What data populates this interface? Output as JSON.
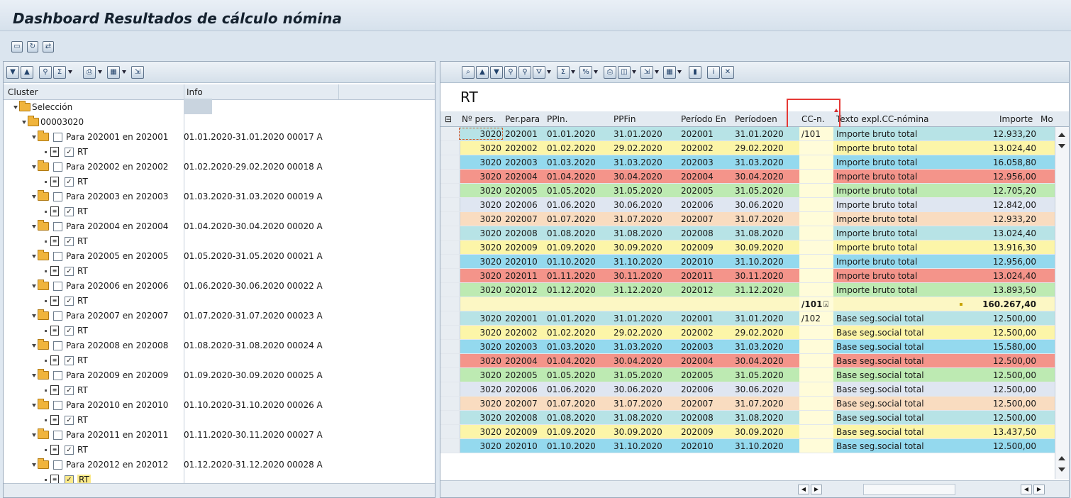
{
  "app": {
    "title": "Dashboard Resultados de cálculo nómina",
    "toolbar_icons": [
      "display-icon",
      "refresh-icon",
      "transfer-icon"
    ]
  },
  "tree": {
    "headers": {
      "cluster": "Cluster",
      "info": "Info"
    },
    "root": "Selección",
    "person": "00003020",
    "rt_label": "RT",
    "periods": [
      {
        "label": "Para 202001 en 202001",
        "info": "01.01.2020-31.01.2020 00017 A"
      },
      {
        "label": "Para 202002 en 202002",
        "info": "01.02.2020-29.02.2020 00018 A"
      },
      {
        "label": "Para 202003 en 202003",
        "info": "01.03.2020-31.03.2020 00019 A"
      },
      {
        "label": "Para 202004 en 202004",
        "info": "01.04.2020-30.04.2020 00020 A"
      },
      {
        "label": "Para 202005 en 202005",
        "info": "01.05.2020-31.05.2020 00021 A"
      },
      {
        "label": "Para 202006 en 202006",
        "info": "01.06.2020-30.06.2020 00022 A"
      },
      {
        "label": "Para 202007 en 202007",
        "info": "01.07.2020-31.07.2020 00023 A"
      },
      {
        "label": "Para 202008 en 202008",
        "info": "01.08.2020-31.08.2020 00024 A"
      },
      {
        "label": "Para 202009 en 202009",
        "info": "01.09.2020-30.09.2020 00025 A"
      },
      {
        "label": "Para 202010 en 202010",
        "info": "01.10.2020-31.10.2020 00026 A"
      },
      {
        "label": "Para 202011 en 202011",
        "info": "01.11.2020-30.11.2020 00027 A"
      },
      {
        "label": "Para 202012 en 202012",
        "info": "01.12.2020-31.12.2020 00028 A"
      }
    ]
  },
  "grid": {
    "title": "RT",
    "headers": {
      "pers": "Nº pers.",
      "perpara": "Per.para",
      "ppin": "PPIn.",
      "ppfin": "PPFin",
      "periodo_en": "Período En",
      "periodoen": "Períodoen",
      "cc": "CC-n.",
      "texto": "Texto expl.CC-nómina",
      "importe": "Importe",
      "mo": "Mo"
    },
    "rows": [
      {
        "pers": "3020",
        "perpara": "202001",
        "ppin": "01.01.2020",
        "ppfin": "31.01.2020",
        "periodo_en": "202001",
        "periodoen": "31.01.2020",
        "cc": "/101",
        "texto": "Importe bruto total",
        "importe": "12.933,20",
        "color": "#b7e3e6"
      },
      {
        "pers": "3020",
        "perpara": "202002",
        "ppin": "01.02.2020",
        "ppfin": "29.02.2020",
        "periodo_en": "202002",
        "periodoen": "29.02.2020",
        "cc": "",
        "texto": "Importe bruto total",
        "importe": "13.024,40",
        "color": "#fcf5a8"
      },
      {
        "pers": "3020",
        "perpara": "202003",
        "ppin": "01.03.2020",
        "ppfin": "31.03.2020",
        "periodo_en": "202003",
        "periodoen": "31.03.2020",
        "cc": "",
        "texto": "Importe bruto total",
        "importe": "16.058,80",
        "color": "#94d9ee"
      },
      {
        "pers": "3020",
        "perpara": "202004",
        "ppin": "01.04.2020",
        "ppfin": "30.04.2020",
        "periodo_en": "202004",
        "periodoen": "30.04.2020",
        "cc": "",
        "texto": "Importe bruto total",
        "importe": "12.956,00",
        "color": "#f4948a"
      },
      {
        "pers": "3020",
        "perpara": "202005",
        "ppin": "01.05.2020",
        "ppfin": "31.05.2020",
        "periodo_en": "202005",
        "periodoen": "31.05.2020",
        "cc": "",
        "texto": "Importe bruto total",
        "importe": "12.705,20",
        "color": "#bdeab2"
      },
      {
        "pers": "3020",
        "perpara": "202006",
        "ppin": "01.06.2020",
        "ppfin": "30.06.2020",
        "periodo_en": "202006",
        "periodoen": "30.06.2020",
        "cc": "",
        "texto": "Importe bruto total",
        "importe": "12.842,00",
        "color": "#dfe6f1"
      },
      {
        "pers": "3020",
        "perpara": "202007",
        "ppin": "01.07.2020",
        "ppfin": "31.07.2020",
        "periodo_en": "202007",
        "periodoen": "31.07.2020",
        "cc": "",
        "texto": "Importe bruto total",
        "importe": "12.933,20",
        "color": "#f9dcc0"
      },
      {
        "pers": "3020",
        "perpara": "202008",
        "ppin": "01.08.2020",
        "ppfin": "31.08.2020",
        "periodo_en": "202008",
        "periodoen": "31.08.2020",
        "cc": "",
        "texto": "Importe bruto total",
        "importe": "13.024,40",
        "color": "#b7e3e6"
      },
      {
        "pers": "3020",
        "perpara": "202009",
        "ppin": "01.09.2020",
        "ppfin": "30.09.2020",
        "periodo_en": "202009",
        "periodoen": "30.09.2020",
        "cc": "",
        "texto": "Importe bruto total",
        "importe": "13.916,30",
        "color": "#fcf5a8"
      },
      {
        "pers": "3020",
        "perpara": "202010",
        "ppin": "01.10.2020",
        "ppfin": "31.10.2020",
        "periodo_en": "202010",
        "periodoen": "31.10.2020",
        "cc": "",
        "texto": "Importe bruto total",
        "importe": "12.956,00",
        "color": "#94d9ee"
      },
      {
        "pers": "3020",
        "perpara": "202011",
        "ppin": "01.11.2020",
        "ppfin": "30.11.2020",
        "periodo_en": "202011",
        "periodoen": "30.11.2020",
        "cc": "",
        "texto": "Importe bruto total",
        "importe": "13.024,40",
        "color": "#f4948a"
      },
      {
        "pers": "3020",
        "perpara": "202012",
        "ppin": "01.12.2020",
        "ppfin": "31.12.2020",
        "periodo_en": "202012",
        "periodoen": "31.12.2020",
        "cc": "",
        "texto": "Importe bruto total",
        "importe": "13.893,50",
        "color": "#bdeab2"
      },
      {
        "total": true,
        "cc": "/101",
        "importe": "160.267,40",
        "color": "#fcf7c4"
      },
      {
        "pers": "3020",
        "perpara": "202001",
        "ppin": "01.01.2020",
        "ppfin": "31.01.2020",
        "periodo_en": "202001",
        "periodoen": "31.01.2020",
        "cc": "/102",
        "texto": "Base seg.social total",
        "importe": "12.500,00",
        "color": "#b7e3e6"
      },
      {
        "pers": "3020",
        "perpara": "202002",
        "ppin": "01.02.2020",
        "ppfin": "29.02.2020",
        "periodo_en": "202002",
        "periodoen": "29.02.2020",
        "cc": "",
        "texto": "Base seg.social total",
        "importe": "12.500,00",
        "color": "#fcf5a8"
      },
      {
        "pers": "3020",
        "perpara": "202003",
        "ppin": "01.03.2020",
        "ppfin": "31.03.2020",
        "periodo_en": "202003",
        "periodoen": "31.03.2020",
        "cc": "",
        "texto": "Base seg.social total",
        "importe": "15.580,00",
        "color": "#94d9ee"
      },
      {
        "pers": "3020",
        "perpara": "202004",
        "ppin": "01.04.2020",
        "ppfin": "30.04.2020",
        "periodo_en": "202004",
        "periodoen": "30.04.2020",
        "cc": "",
        "texto": "Base seg.social total",
        "importe": "12.500,00",
        "color": "#f4948a"
      },
      {
        "pers": "3020",
        "perpara": "202005",
        "ppin": "01.05.2020",
        "ppfin": "31.05.2020",
        "periodo_en": "202005",
        "periodoen": "31.05.2020",
        "cc": "",
        "texto": "Base seg.social total",
        "importe": "12.500,00",
        "color": "#bdeab2"
      },
      {
        "pers": "3020",
        "perpara": "202006",
        "ppin": "01.06.2020",
        "ppfin": "30.06.2020",
        "periodo_en": "202006",
        "periodoen": "30.06.2020",
        "cc": "",
        "texto": "Base seg.social total",
        "importe": "12.500,00",
        "color": "#dfe6f1"
      },
      {
        "pers": "3020",
        "perpara": "202007",
        "ppin": "01.07.2020",
        "ppfin": "31.07.2020",
        "periodo_en": "202007",
        "periodoen": "31.07.2020",
        "cc": "",
        "texto": "Base seg.social total",
        "importe": "12.500,00",
        "color": "#f9dcc0"
      },
      {
        "pers": "3020",
        "perpara": "202008",
        "ppin": "01.08.2020",
        "ppfin": "31.08.2020",
        "periodo_en": "202008",
        "periodoen": "31.08.2020",
        "cc": "",
        "texto": "Base seg.social total",
        "importe": "12.500,00",
        "color": "#b7e3e6"
      },
      {
        "pers": "3020",
        "perpara": "202009",
        "ppin": "01.09.2020",
        "ppfin": "30.09.2020",
        "periodo_en": "202009",
        "periodoen": "30.09.2020",
        "cc": "",
        "texto": "Base seg.social total",
        "importe": "13.437,50",
        "color": "#fcf5a8"
      },
      {
        "pers": "3020",
        "perpara": "202010",
        "ppin": "01.10.2020",
        "ppfin": "31.10.2020",
        "periodo_en": "202010",
        "periodoen": "31.10.2020",
        "cc": "",
        "texto": "Base seg.social total",
        "importe": "12.500,00",
        "color": "#94d9ee"
      }
    ]
  }
}
